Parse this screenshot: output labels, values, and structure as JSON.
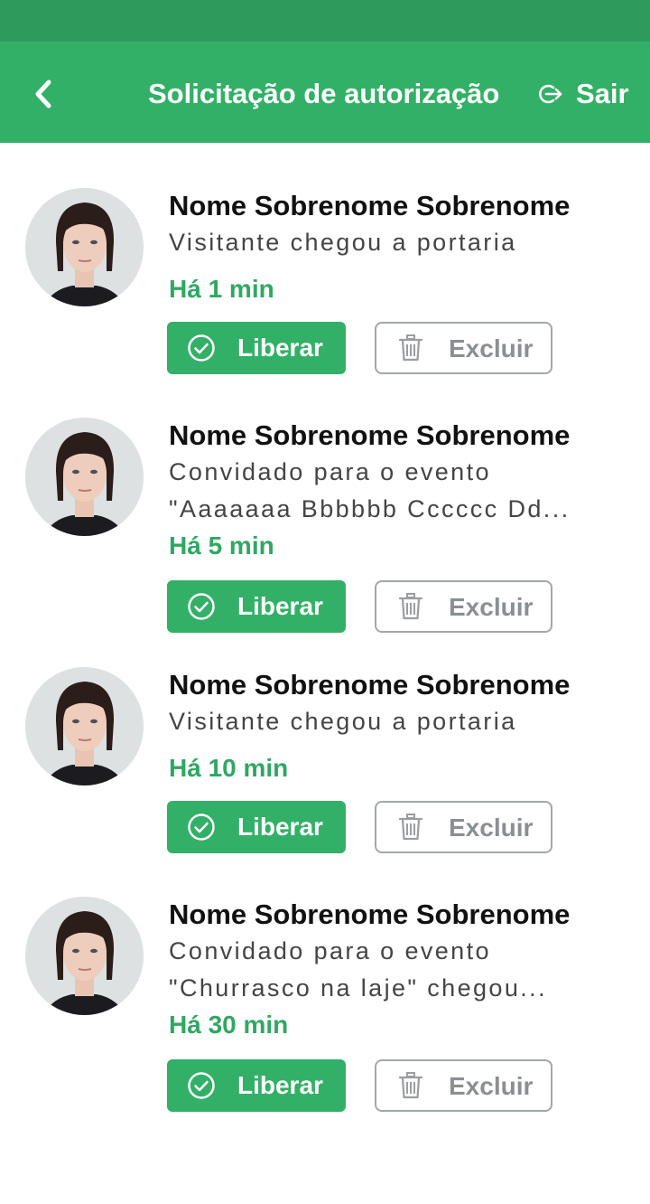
{
  "header": {
    "title": "Solicitação de autorização",
    "logout_label": "Sair",
    "accent_color": "#33b067"
  },
  "requests": [
    {
      "name": "Nome Sobrenome Sobrenome",
      "description_lines": [
        "Visitante chegou a portaria"
      ],
      "time": "Há 1 min",
      "approve_label": "Liberar",
      "delete_label": "Excluir"
    },
    {
      "name": "Nome Sobrenome Sobrenome",
      "description_lines": [
        "Convidado para o evento",
        "\"Aaaaaaa Bbbbbb Cccccc Dd..."
      ],
      "time": "Há 5 min",
      "approve_label": "Liberar",
      "delete_label": "Excluir"
    },
    {
      "name": "Nome Sobrenome Sobrenome",
      "description_lines": [
        "Visitante chegou a portaria"
      ],
      "time": "Há 10 min",
      "approve_label": "Liberar",
      "delete_label": "Excluir"
    },
    {
      "name": "Nome Sobrenome Sobrenome",
      "description_lines": [
        "Convidado para o evento",
        "\"Churrasco na laje\" chegou..."
      ],
      "time": "Há 30 min",
      "approve_label": "Liberar",
      "delete_label": "Excluir"
    }
  ]
}
